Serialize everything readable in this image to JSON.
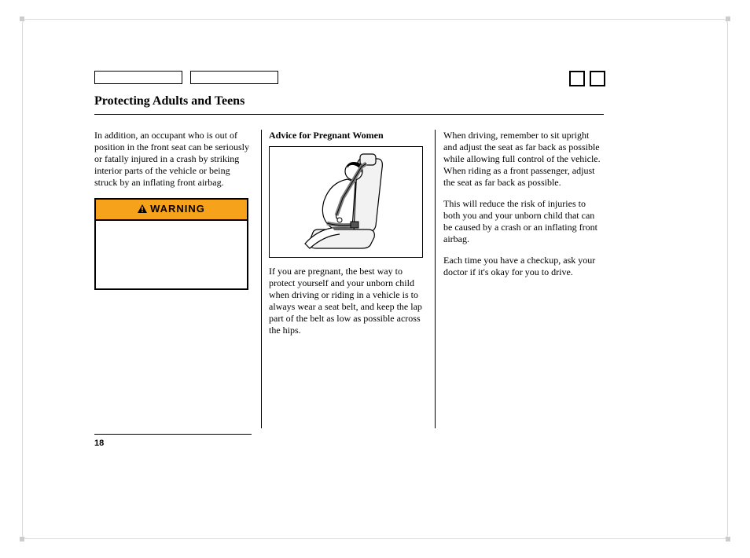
{
  "title": "Protecting Adults and Teens",
  "page_number": "18",
  "warning": {
    "label": "WARNING"
  },
  "col1": {
    "p1": "In addition, an occupant who is out of position in the front seat can be seriously or fatally injured in a crash by striking interior parts of the vehicle or being struck by an inflating front airbag."
  },
  "col2": {
    "subheading": "Advice for Pregnant Women",
    "p1": "If you are pregnant, the best way to protect yourself and your unborn child when driving or riding in a vehicle is to always wear a seat belt, and keep the lap part of the belt as low as possible across the hips."
  },
  "col3": {
    "p1": "When driving, remember to sit upright and adjust the seat as far back as possible while allowing full control of the vehicle. When riding as a front passenger, adjust the seat as far back as possible.",
    "p2": "This will reduce the risk of injuries to both you and your unborn child that can be caused by a crash or an inflating front airbag.",
    "p3": "Each time you have a checkup, ask your doctor if it's okay for you to drive."
  }
}
